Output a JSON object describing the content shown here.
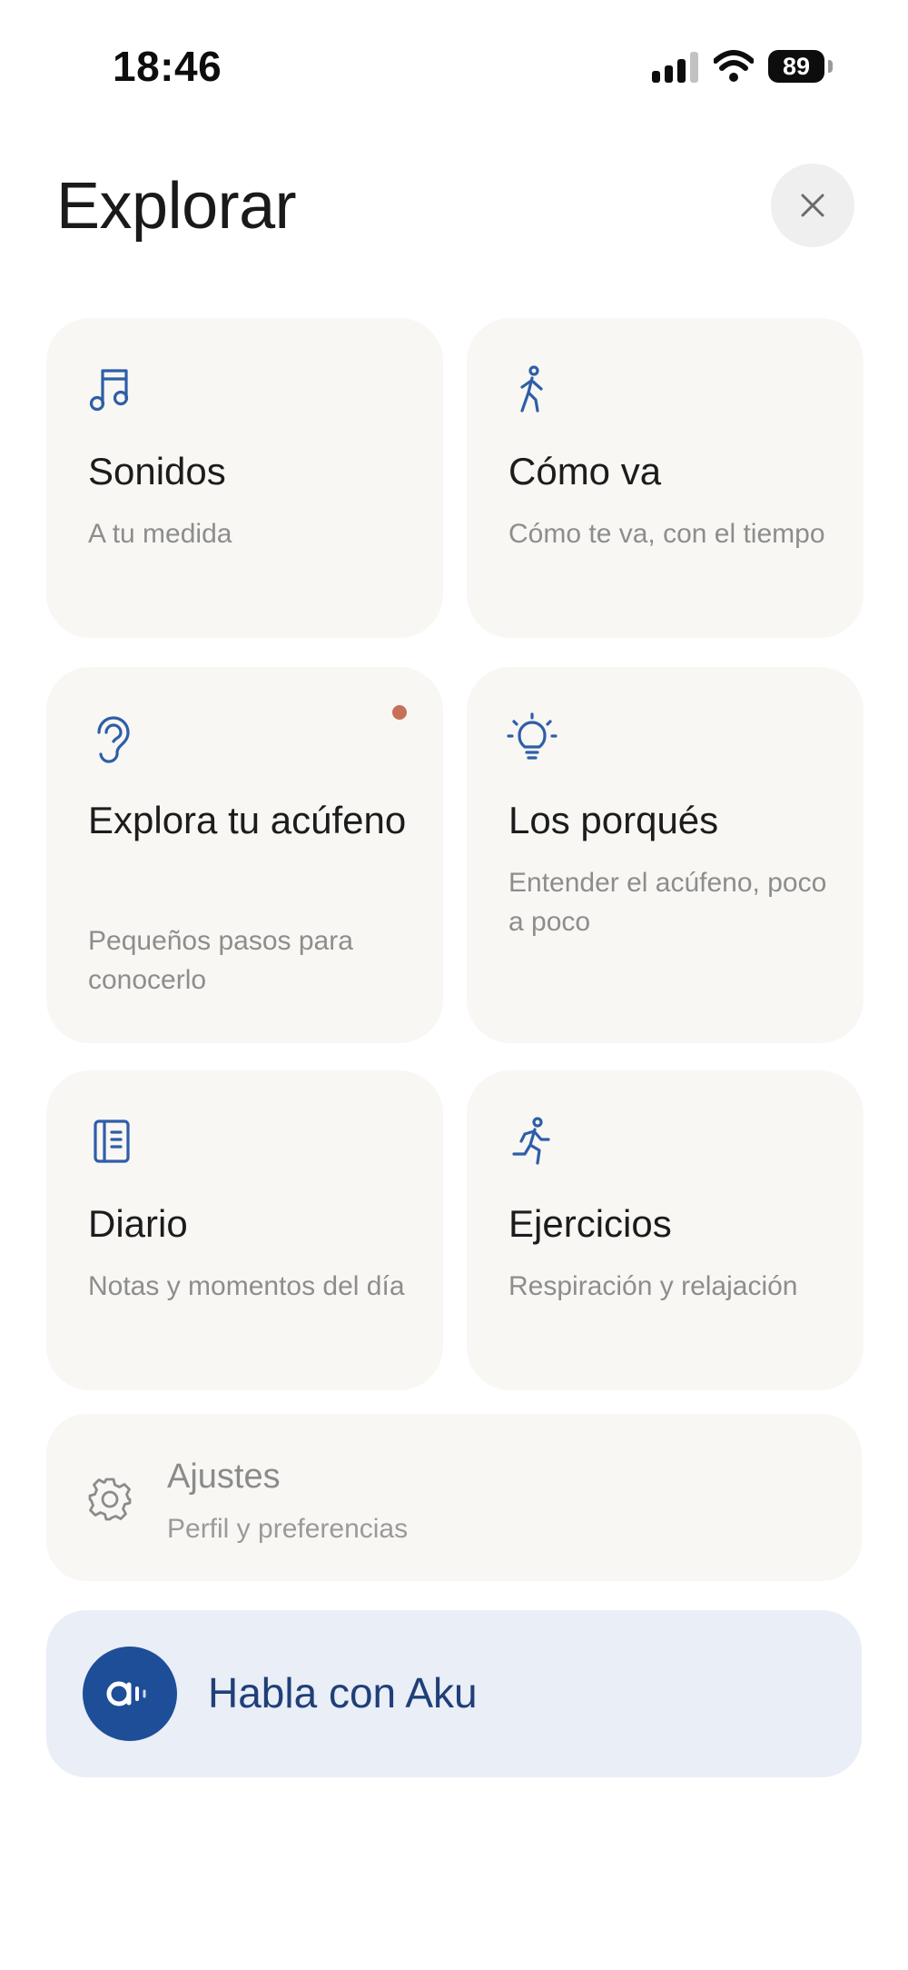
{
  "status_bar": {
    "time": "18:46",
    "battery": "89",
    "icons": [
      "cellular-signal-icon",
      "wifi-icon",
      "battery-icon"
    ]
  },
  "header": {
    "title": "Explorar",
    "close_icon": "close-icon"
  },
  "cards": [
    {
      "id": "sonidos",
      "icon": "music-note-icon",
      "title": "Sonidos",
      "subtitle": "A tu medida"
    },
    {
      "id": "como-va",
      "icon": "walking-person-icon",
      "title": "Cómo va",
      "subtitle": "Cómo te va, con el tiempo"
    },
    {
      "id": "explora",
      "icon": "ear-icon",
      "title": "Explora tu acúfeno",
      "subtitle": "Pequeños pasos para conocerlo",
      "notification_dot": true
    },
    {
      "id": "porques",
      "icon": "lightbulb-icon",
      "title": "Los porqués",
      "subtitle": "Entender el acúfeno, poco a poco"
    },
    {
      "id": "diario",
      "icon": "notebook-icon",
      "title": "Diario",
      "subtitle": "Notas y momentos del día"
    },
    {
      "id": "ejercicios",
      "icon": "running-person-icon",
      "title": "Ejercicios",
      "subtitle": "Respiración y relajación"
    }
  ],
  "settings": {
    "icon": "gear-icon",
    "title": "Ajustes",
    "subtitle": "Perfil y preferencias"
  },
  "chat": {
    "icon": "aku-avatar-icon",
    "label": "Habla con Aku"
  },
  "colors": {
    "accent": "#2f5ea8",
    "card_bg": "#f8f7f4",
    "chat_bg": "#e9eef7",
    "avatar_bg": "#1f4e98",
    "notification_dot": "#c77058"
  }
}
